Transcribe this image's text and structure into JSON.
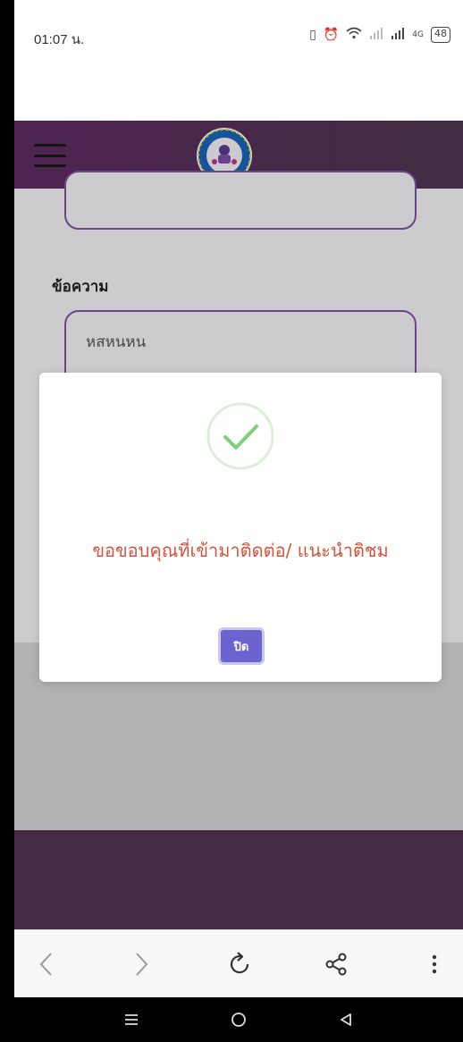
{
  "status_bar": {
    "time": "01:07 น.",
    "battery": "48",
    "network": "4G",
    "icons": [
      "vibrate-icon",
      "alarm-icon",
      "wifi-icon",
      "signal-icon",
      "signal-icon",
      "battery-icon"
    ]
  },
  "header": {
    "menu_icon": "hamburger-menu-icon",
    "logo": "organization-seal-logo"
  },
  "form": {
    "message_label": "ข้อความ",
    "message_value": "หสหนหน"
  },
  "modal": {
    "icon": "check-circle-icon",
    "message": "ขอขอบคุณที่เข้ามาติดต่อ/ แนะนำติชม",
    "close_label": "ปิด"
  },
  "browser_toolbar": {
    "icons": [
      "back-arrow-icon",
      "forward-arrow-icon",
      "reload-icon",
      "share-icon",
      "more-icon"
    ]
  },
  "nav_bar": {
    "icons": [
      "recent-apps-icon",
      "home-icon",
      "back-icon"
    ]
  },
  "colors": {
    "header": "#5a2d5e",
    "footer": "#543353",
    "accent_border": "#7c55a4",
    "success": "#7ed07a",
    "message_text": "#d4533b",
    "button": "#6c63cf"
  }
}
